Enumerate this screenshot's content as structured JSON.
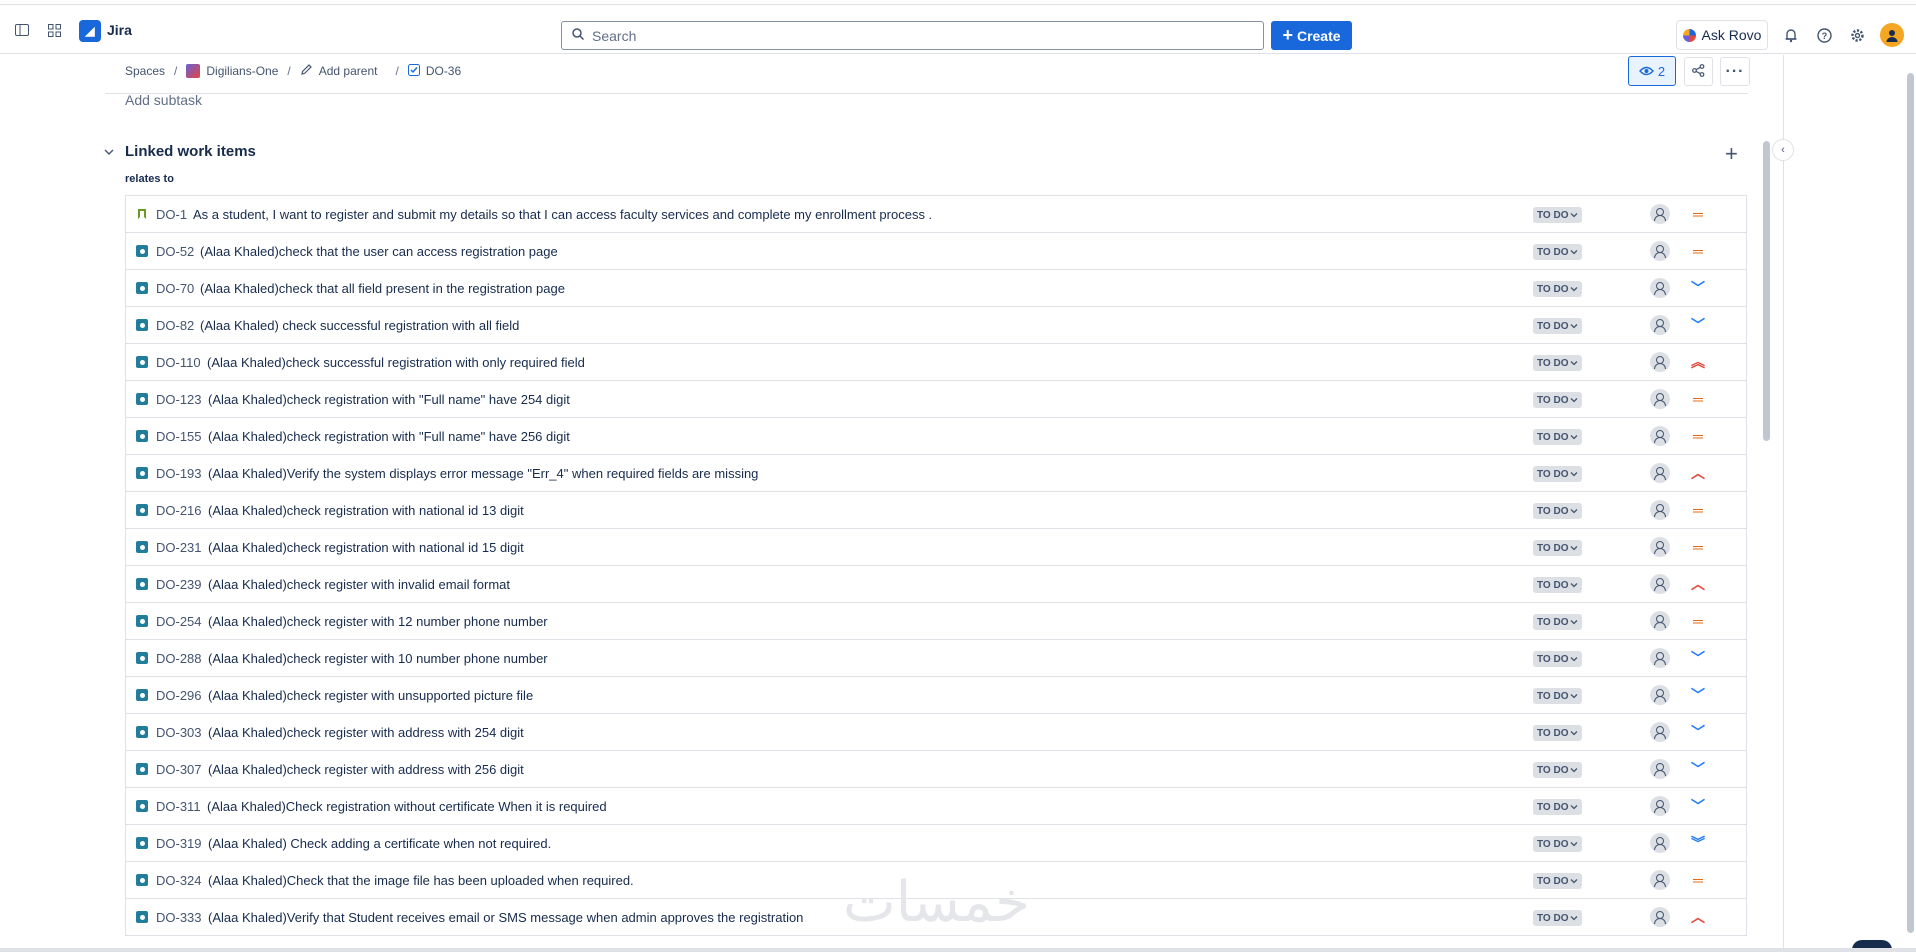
{
  "app": {
    "title": "Jira"
  },
  "search": {
    "placeholder": "Search"
  },
  "toolbar": {
    "create_label": "Create",
    "ask_rovo_label": "Ask Rovo"
  },
  "breadcrumb": {
    "spaces": "Spaces",
    "project": "Digilians-One",
    "add_parent": "Add parent",
    "issue_key": "DO-36"
  },
  "issue_actions": {
    "watchers_count": "2"
  },
  "add_subtask_label": "Add subtask",
  "linked_items": {
    "title": "Linked work items",
    "relation_label": "relates to",
    "items": [
      {
        "type": "story",
        "key": "DO-1",
        "summary": "As a student, I want to register and submit my details so that I can access faculty services and complete my enrollment process .",
        "status": "TO DO",
        "priority": "medium"
      },
      {
        "type": "test",
        "key": "DO-52",
        "summary": "(Alaa Khaled)check that the user can access registration page",
        "status": "TO DO",
        "priority": "medium"
      },
      {
        "type": "test",
        "key": "DO-70",
        "summary": "(Alaa Khaled)check that all field present in the registration page",
        "status": "TO DO",
        "priority": "low"
      },
      {
        "type": "test",
        "key": "DO-82",
        "summary": "(Alaa Khaled) check successful registration with all field",
        "status": "TO DO",
        "priority": "low"
      },
      {
        "type": "test",
        "key": "DO-110",
        "summary": "(Alaa Khaled)check successful registration with only required field",
        "status": "TO DO",
        "priority": "highest"
      },
      {
        "type": "test",
        "key": "DO-123",
        "summary": "(Alaa Khaled)check registration with \"Full name\" have 254 digit",
        "status": "TO DO",
        "priority": "medium"
      },
      {
        "type": "test",
        "key": "DO-155",
        "summary": "(Alaa Khaled)check registration with \"Full name\" have 256 digit",
        "status": "TO DO",
        "priority": "medium"
      },
      {
        "type": "test",
        "key": "DO-193",
        "summary": "(Alaa Khaled)Verify the system displays error message \"Err_4\" when required fields are missing",
        "status": "TO DO",
        "priority": "high"
      },
      {
        "type": "test",
        "key": "DO-216",
        "summary": "(Alaa Khaled)check registration with national id 13 digit",
        "status": "TO DO",
        "priority": "medium"
      },
      {
        "type": "test",
        "key": "DO-231",
        "summary": "(Alaa Khaled)check registration with national id 15 digit",
        "status": "TO DO",
        "priority": "medium"
      },
      {
        "type": "test",
        "key": "DO-239",
        "summary": "(Alaa Khaled)check register with invalid email format",
        "status": "TO DO",
        "priority": "high"
      },
      {
        "type": "test",
        "key": "DO-254",
        "summary": "(Alaa Khaled)check register with 12 number phone number",
        "status": "TO DO",
        "priority": "medium"
      },
      {
        "type": "test",
        "key": "DO-288",
        "summary": "(Alaa Khaled)check register with 10 number phone number",
        "status": "TO DO",
        "priority": "low"
      },
      {
        "type": "test",
        "key": "DO-296",
        "summary": "(Alaa Khaled)check register with unsupported picture file",
        "status": "TO DO",
        "priority": "low"
      },
      {
        "type": "test",
        "key": "DO-303",
        "summary": "(Alaa Khaled)check register with address with 254 digit",
        "status": "TO DO",
        "priority": "low"
      },
      {
        "type": "test",
        "key": "DO-307",
        "summary": "(Alaa Khaled)check register with address with 256 digit",
        "status": "TO DO",
        "priority": "low"
      },
      {
        "type": "test",
        "key": "DO-311",
        "summary": "(Alaa Khaled)Check registration without certificate When it is required",
        "status": "TO DO",
        "priority": "low"
      },
      {
        "type": "test",
        "key": "DO-319",
        "summary": "(Alaa Khaled) Check adding a certificate when not required.",
        "status": "TO DO",
        "priority": "lowest"
      },
      {
        "type": "test",
        "key": "DO-324",
        "summary": "(Alaa Khaled)Check that the image file has been uploaded when required.",
        "status": "TO DO",
        "priority": "medium"
      },
      {
        "type": "test",
        "key": "DO-333",
        "summary": "(Alaa Khaled)Verify that Student receives email or SMS message when admin approves the registration",
        "status": "TO DO",
        "priority": "high"
      }
    ]
  },
  "priority_glyphs": {
    "medium": "═",
    "low": "﹀",
    "lowest": "︾",
    "high": "︿",
    "highest": "︽"
  },
  "colors": {
    "brand": "#1868db",
    "status_todo_bg": "#dcdfe4",
    "priority_medium": "#e56910",
    "priority_low": "#1d7afc",
    "priority_high": "#e2483d"
  },
  "icons": [
    "sidebar-toggle-icon",
    "app-switcher-icon",
    "search-icon",
    "plus-icon",
    "bell-icon",
    "help-icon",
    "gear-icon",
    "eye-icon",
    "share-icon",
    "more-icon",
    "chevron-down-icon",
    "chevron-left-icon",
    "story-icon",
    "test-icon",
    "person-icon"
  ],
  "watermark_text": "خمسات"
}
